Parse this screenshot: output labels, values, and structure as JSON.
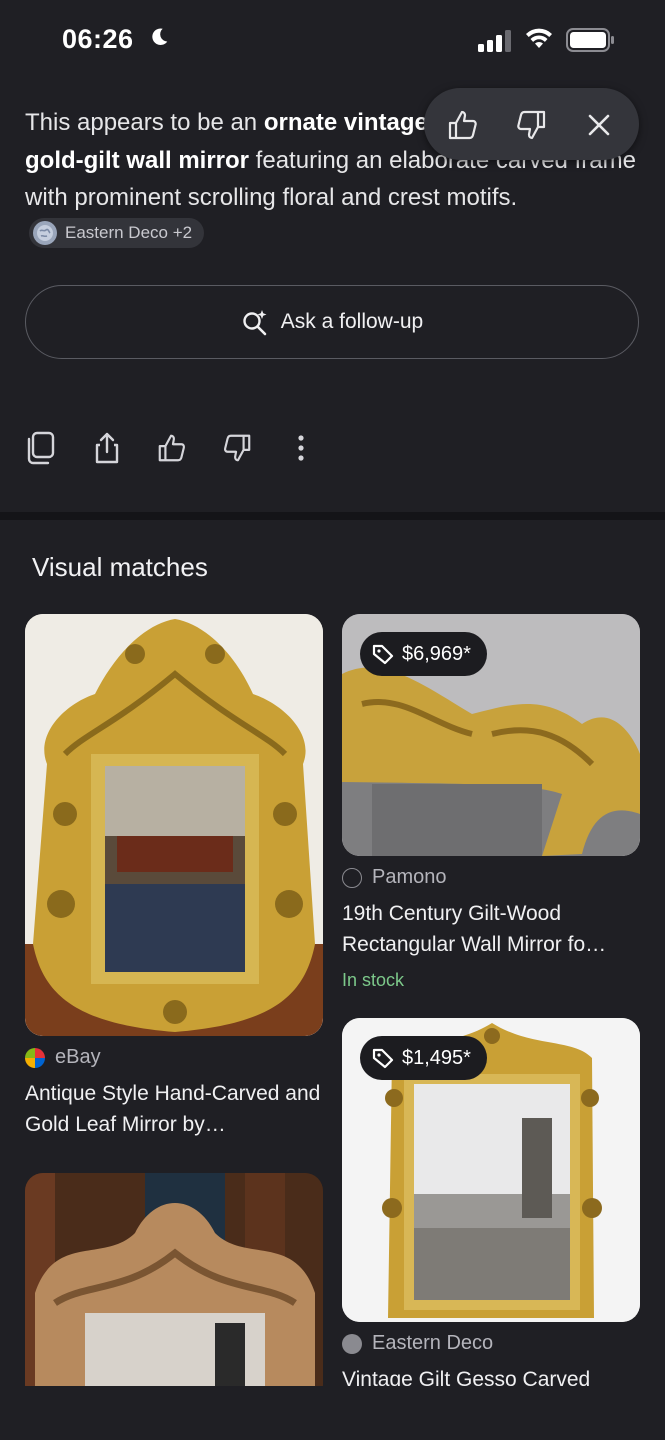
{
  "status": {
    "time": "06:26"
  },
  "summary": {
    "pre": "This appears to be an ",
    "bold": "ornate vintage Baroque-style gold-gilt wall mirror",
    "post": " featuring an elaborate carved frame with prominent scrolling floral and crest motifs.",
    "source_chip": "Eastern Deco +2"
  },
  "followup_label": "Ask a follow-up",
  "section_title": "Visual matches",
  "cards": [
    {
      "source": "eBay",
      "title": "Antique Style Hand-Carved and Gold Leaf Mirror by…"
    },
    {
      "source": "Pamono",
      "price": "$6,969*",
      "title": "19th Century Gilt-Wood Rectangular Wall Mirror fo…",
      "stock": "In stock"
    },
    {
      "source": "Eastern Deco",
      "price": "$1,495*",
      "title": "Vintage Gilt Gesso Carved"
    },
    {
      "source": "",
      "title": ""
    }
  ],
  "colors": {
    "background": "#1f1f24",
    "accent_gold": "#c9a035",
    "in_stock": "#7cc88a"
  }
}
